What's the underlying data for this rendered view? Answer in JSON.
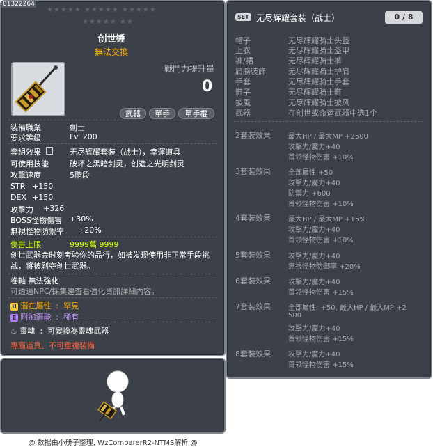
{
  "item": {
    "id": "01322264",
    "stars_row1": "★★★★★  ★★★★★  ★★★★★",
    "stars_row2": "★★★★★  ★★",
    "name": "创世锤",
    "tradeability": "無法交換",
    "power_label": "戰鬥力提升量",
    "power_value": "0",
    "tags": [
      "武器",
      "單手",
      "單手棍"
    ],
    "job_label": "裝備職業",
    "job_value": "劍士",
    "level_label": "要求等級",
    "level_value": "Lv. 200",
    "set_effect_label": "套組效果",
    "set_effect_value": "无尽辉耀套装（战士），幸運道具",
    "skill_label": "可使用技能",
    "skill_value": "破坏之黑暗剑灵，创造之光明剑灵",
    "speed_label": "攻擊速度",
    "speed_value": "5階段",
    "str_label": "STR",
    "str_value": "+150",
    "dex_label": "DEX",
    "dex_value": "+150",
    "atk_label": "攻擊力",
    "atk_value": "+326",
    "boss_label": "BOSS怪物傷害",
    "boss_value": "+30%",
    "ignore_label": "無視怪物防禦率",
    "ignore_value": "+20%",
    "damcap_label": "傷害上限",
    "damcap_value": "9999萬 9999",
    "desc": "创世武器会时刻考验你的品行，如被发现使用非正常手段挑战，将被剥夺创世武器。",
    "scroll_text": "卷軸 無法強化",
    "transfer_text": "可透過NPC/採集建查看強化資訊詳細內容。",
    "potential_label": "潛在屬性",
    "potential_value": "罕見",
    "bonus_label": "附加潛能",
    "bonus_value": "稀有",
    "soul_label": "靈魂",
    "soul_value": "可變換為靈魂武器",
    "exclusive_text": "專屬道具。不可重複裝備"
  },
  "set": {
    "badge": "SET",
    "title": "无尽辉耀套装（战士）",
    "count": "0 / 8",
    "parts": [
      {
        "slot": "帽子",
        "name": "无尽辉耀骑士头盔"
      },
      {
        "slot": "上衣",
        "name": "无尽辉耀骑士盔甲"
      },
      {
        "slot": "褲/裙",
        "name": "无尽辉耀骑士裤"
      },
      {
        "slot": "肩膀裝飾",
        "name": "无尽辉耀骑士护肩"
      },
      {
        "slot": "手套",
        "name": "无尽辉耀骑士手套"
      },
      {
        "slot": "鞋子",
        "name": "无尽辉耀骑士鞋"
      },
      {
        "slot": "披風",
        "name": "无尽辉耀骑士披风"
      },
      {
        "slot": "武器",
        "name": "在创世或命运武器中选1个"
      }
    ],
    "effects": [
      {
        "label": "2套裝效果",
        "lines": [
          "最大HP / 最大MP  +2500",
          "攻擊力/魔力+40",
          "首领怪物伤害 +10%"
        ]
      },
      {
        "label": "3套裝效果",
        "lines": [
          "全部屬性 +50",
          "攻擊力/魔力+40",
          "防禦力 +600",
          "首领怪物伤害 +10%"
        ]
      },
      {
        "label": "4套裝效果",
        "lines": [
          "最大HP / 最大MP  +15%",
          "攻擊力/魔力+40",
          "首领怪物伤害 +10%"
        ]
      },
      {
        "label": "5套裝效果",
        "lines": [
          "攻擊力/魔力+40",
          "無視怪物防御率 +20%"
        ]
      },
      {
        "label": "6套裝效果",
        "lines": [
          "攻擊力/魔力+40",
          "首领怪物伤害 +15%"
        ]
      },
      {
        "label": "7套裝效果",
        "lines": [
          "全部屬性: +50, 最大HP / 最大MP  +2",
          "500",
          "攻擊力/魔力+40",
          "首领怪物伤害 +15%"
        ]
      },
      {
        "label": "8套裝效果",
        "lines": [
          "攻擊力/魔力+40",
          "首领怪物伤害 +15%"
        ]
      }
    ]
  },
  "footer": "@ 数据由小册子整理, WzComparerR2-NTMS解析 @",
  "colors": {
    "panel_bg": "#3c4149",
    "panel_border": "#7d838b",
    "accent_orange": "#ffaa00",
    "damcap_green": "#ccff00",
    "exclusive_red": "#ff5e3a"
  }
}
